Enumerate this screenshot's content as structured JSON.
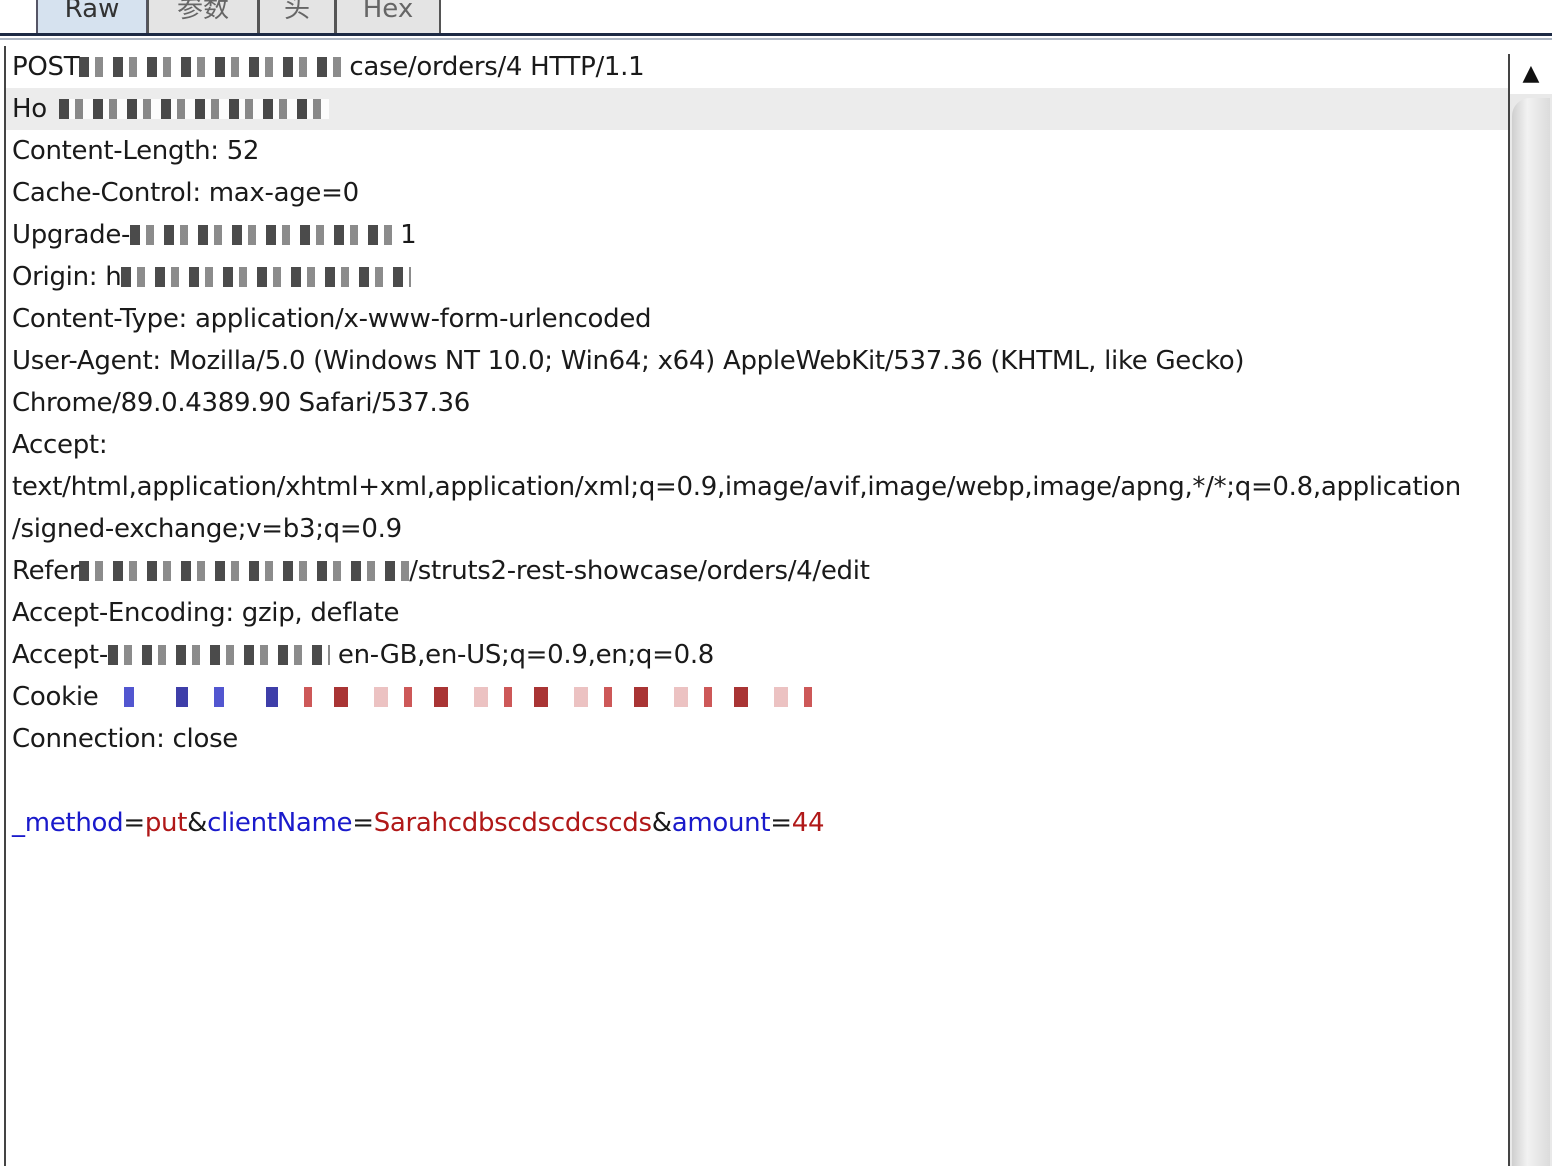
{
  "tabs": [
    {
      "label": "Raw",
      "active": true
    },
    {
      "label": "参数",
      "active": false
    },
    {
      "label": "头",
      "active": false
    },
    {
      "label": "Hex",
      "active": false
    }
  ],
  "request": {
    "request_line_method": "POST",
    "request_line_path_tail": "case/orders/4 HTTP/1.1",
    "host_label": "Ho",
    "content_length": "Content-Length: 52",
    "cache_control": "Cache-Control: max-age=0",
    "upgrade_prefix": "Upgrade-",
    "upgrade_suffix": " 1",
    "origin_label": "Origin: h",
    "content_type": "Content-Type: application/x-www-form-urlencoded",
    "user_agent_1": "User-Agent: Mozilla/5.0 (Windows NT 10.0; Win64; x64) AppleWebKit/537.36 (KHTML, like Gecko)",
    "user_agent_2": "Chrome/89.0.4389.90 Safari/537.36",
    "accept_label": "Accept:",
    "accept_1": "text/html,application/xhtml+xml,application/xml;q=0.9,image/avif,image/webp,image/apng,*/*;q=0.8,application",
    "accept_2": "/signed-exchange;v=b3;q=0.9",
    "referer_label": "Refer",
    "referer_tail": "/struts2-rest-showcase/orders/4/edit",
    "accept_encoding": "Accept-Encoding: gzip, deflate",
    "accept_language_prefix": "Accept-",
    "accept_language_tail": " en-GB,en-US;q=0.9,en;q=0.8",
    "cookie_label": "Cookie",
    "connection": "Connection: close"
  },
  "body": {
    "p1_name": "_method",
    "p1_value": "put",
    "p2_name": "clientName",
    "p2_value": "Sarahcdbscdscdcscds",
    "p3_name": "amount",
    "p3_value": "44",
    "eq": "=",
    "amp": "&"
  },
  "scrollbar": {
    "up_arrow": "▲"
  },
  "colors": {
    "param_name": "#1a1acb",
    "param_value": "#b01818",
    "highlight_row": "#ececec",
    "active_tab": "#d6e2ef"
  }
}
